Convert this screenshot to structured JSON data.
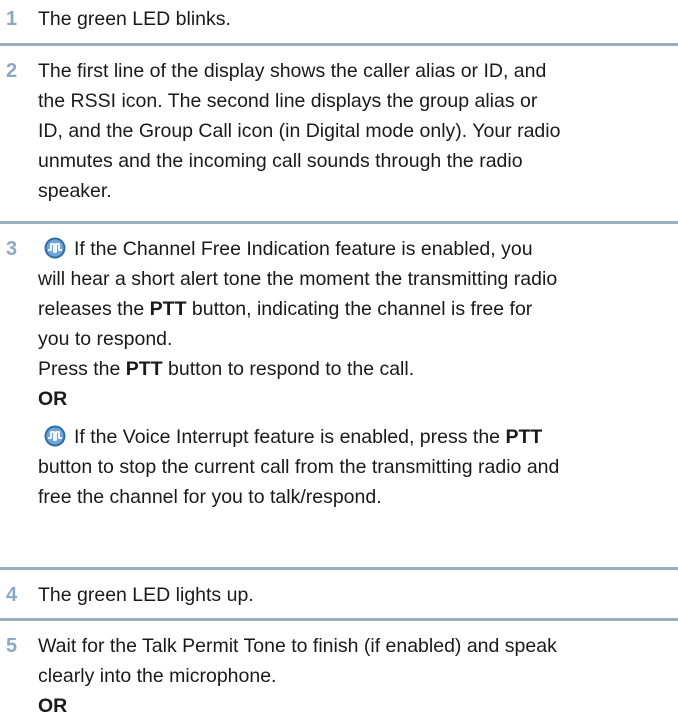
{
  "steps": [
    {
      "number": "1",
      "lines": [
        "The green LED blinks."
      ]
    },
    {
      "number": "2",
      "lines": [
        "The first line of the display shows the caller alias or ID, and",
        "the RSSI icon. The second line displays the group alias or",
        "ID, and the Group Call icon (in Digital mode only). Your radio",
        "unmutes and the incoming call sounds through the radio",
        "speaker."
      ]
    },
    {
      "number": "3",
      "cfi_line1": "If the Channel Free Indication feature is enabled, you",
      "cfi_line2": "will hear a short alert tone the moment the transmitting radio",
      "cfi_line3_pre": "releases the ",
      "cfi_line3_bold": "PTT",
      "cfi_line3_post": " button, indicating the channel is free for",
      "cfi_line4": "you to respond.",
      "press_pre": "Press the ",
      "press_bold": "PTT",
      "press_post": " button to respond to the call.",
      "or_label": "OR",
      "vi_line1_pre": "If the Voice Interrupt feature is enabled, press the ",
      "vi_line1_bold": "PTT",
      "vi_line2": "button to stop the current call from the transmitting radio and",
      "vi_line3": "free the channel for you to talk/respond."
    },
    {
      "number": "4",
      "lines": [
        "The green LED lights up."
      ]
    },
    {
      "number": "5",
      "lines": [
        "Wait for the Talk Permit Tone to finish (if enabled) and speak",
        "clearly into the microphone."
      ],
      "or_label": "OR"
    }
  ],
  "icons": {
    "feature_icon": "programmable-feature-icon",
    "accent_color": "#2e6da4",
    "number_color": "#8ca8c8",
    "rule_color": "#9bafc3"
  }
}
